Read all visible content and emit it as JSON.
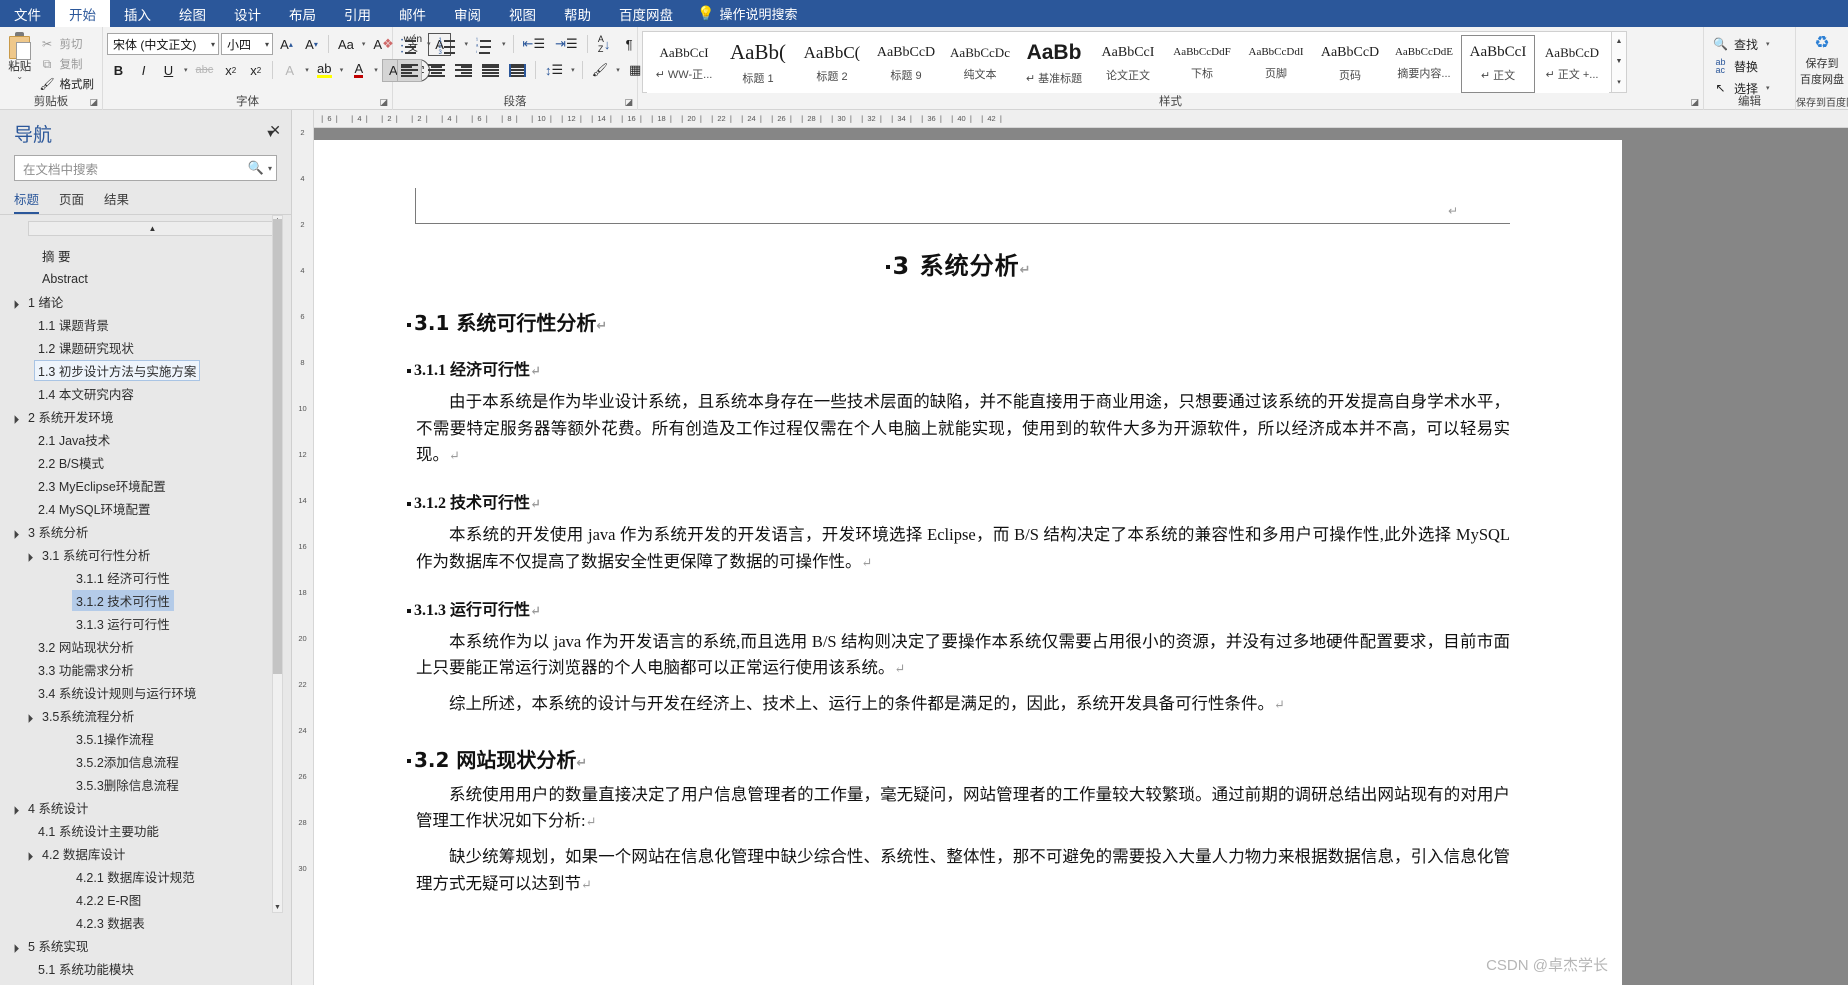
{
  "ribbon": {
    "tabs": [
      {
        "label": "文件",
        "active": false
      },
      {
        "label": "开始",
        "active": true
      },
      {
        "label": "插入",
        "active": false
      },
      {
        "label": "绘图",
        "active": false
      },
      {
        "label": "设计",
        "active": false
      },
      {
        "label": "布局",
        "active": false
      },
      {
        "label": "引用",
        "active": false
      },
      {
        "label": "邮件",
        "active": false
      },
      {
        "label": "审阅",
        "active": false
      },
      {
        "label": "视图",
        "active": false
      },
      {
        "label": "帮助",
        "active": false
      },
      {
        "label": "百度网盘",
        "active": false
      }
    ],
    "tell_me": "操作说明搜索",
    "bulb_icon": "lightbulb-icon",
    "groups": {
      "clipboard": {
        "label": "剪贴板",
        "paste_label": "粘贴",
        "cut_label": "剪切",
        "copy_label": "复制",
        "format_painter_label": "格式刷"
      },
      "font": {
        "label": "字体",
        "font_name": "宋体 (中文正文)",
        "font_size": "小四"
      },
      "paragraph": {
        "label": "段落"
      },
      "styles": {
        "label": "样式",
        "items": [
          {
            "preview": "AaBbCcI",
            "name": "↵ WW-正...",
            "size": 13,
            "serif": true,
            "active": false
          },
          {
            "preview": "AaBb(",
            "name": "标题 1",
            "size": 21,
            "serif": true,
            "active": false
          },
          {
            "preview": "AaBbC(",
            "name": "标题 2",
            "size": 17,
            "serif": true,
            "active": false
          },
          {
            "preview": "AaBbCcD",
            "name": "标题 9",
            "size": 14,
            "serif": true,
            "active": false
          },
          {
            "preview": "AaBbCcDc",
            "name": "纯文本",
            "size": 13,
            "serif": true,
            "active": false
          },
          {
            "preview": "AaBb",
            "name": "↵ 基准标题",
            "size": 21,
            "serif": false,
            "bold": true,
            "active": false
          },
          {
            "preview": "AaBbCcI",
            "name": "论文正文",
            "size": 14,
            "serif": true,
            "active": false
          },
          {
            "preview": "AaBbCcDdF",
            "name": "下标",
            "size": 11,
            "serif": true,
            "active": false
          },
          {
            "preview": "AaBbCcDdI",
            "name": "页脚",
            "size": 11,
            "serif": true,
            "active": false
          },
          {
            "preview": "AaBbCcD",
            "name": "页码",
            "size": 14,
            "serif": true,
            "active": false
          },
          {
            "preview": "AaBbCcDdE",
            "name": "摘要内容...",
            "size": 11,
            "serif": true,
            "active": false
          },
          {
            "preview": "AaBbCcI",
            "name": "↵ 正文",
            "size": 15,
            "serif": true,
            "active": true
          },
          {
            "preview": "AaBbCcD",
            "name": "↵ 正文 +...",
            "size": 13,
            "serif": true,
            "active": false
          }
        ]
      },
      "editing": {
        "label": "编辑",
        "find_label": "查找",
        "replace_label": "替换",
        "select_label": "选择"
      },
      "baidu": {
        "label": "保存到百度网盘",
        "line1": "保存到",
        "line2": "百度网盘"
      }
    }
  },
  "nav": {
    "title": "导航",
    "search_placeholder": "在文档中搜索",
    "tabs": [
      {
        "label": "标题",
        "active": true
      },
      {
        "label": "页面",
        "active": false
      },
      {
        "label": "结果",
        "active": false
      }
    ],
    "items": [
      {
        "label": "摘 要",
        "level": 3,
        "tri": "",
        "state": ""
      },
      {
        "label": "Abstract",
        "level": 3,
        "tri": "",
        "state": ""
      },
      {
        "label": "1 绪论",
        "level": 1,
        "tri": "▲",
        "state": ""
      },
      {
        "label": "1.1 课题背景",
        "level": 2,
        "tri": "",
        "state": ""
      },
      {
        "label": "1.2 课题研究现状",
        "level": 2,
        "tri": "",
        "state": ""
      },
      {
        "label": "1.3 初步设计方法与实施方案",
        "level": 2,
        "tri": "",
        "state": "hov"
      },
      {
        "label": "1.4 本文研究内容",
        "level": 2,
        "tri": "",
        "state": ""
      },
      {
        "label": "2 系统开发环境",
        "level": 1,
        "tri": "▲",
        "state": ""
      },
      {
        "label": "2.1 Java技术",
        "level": 2,
        "tri": "",
        "state": ""
      },
      {
        "label": "2.2 B/S模式",
        "level": 2,
        "tri": "",
        "state": ""
      },
      {
        "label": "2.3 MyEclipse环境配置",
        "level": 2,
        "tri": "",
        "state": ""
      },
      {
        "label": "2.4 MySQL环境配置",
        "level": 2,
        "tri": "",
        "state": ""
      },
      {
        "label": "3 系统分析",
        "level": 1,
        "tri": "▲",
        "state": ""
      },
      {
        "label": "3.1 系统可行性分析",
        "level": 3,
        "tri": "▲",
        "state": ""
      },
      {
        "label": "3.1.1 经济可行性",
        "level": 4,
        "tri": "",
        "state": ""
      },
      {
        "label": "3.1.2 技术可行性",
        "level": 4,
        "tri": "",
        "state": "sel"
      },
      {
        "label": "3.1.3 运行可行性",
        "level": 4,
        "tri": "",
        "state": ""
      },
      {
        "label": "3.2 网站现状分析",
        "level": 2,
        "tri": "",
        "state": ""
      },
      {
        "label": "3.3 功能需求分析",
        "level": 2,
        "tri": "",
        "state": ""
      },
      {
        "label": "3.4 系统设计规则与运行环境",
        "level": 2,
        "tri": "",
        "state": ""
      },
      {
        "label": "3.5系统流程分析",
        "level": 3,
        "tri": "▲",
        "state": ""
      },
      {
        "label": "3.5.1操作流程",
        "level": 4,
        "tri": "",
        "state": ""
      },
      {
        "label": "3.5.2添加信息流程",
        "level": 4,
        "tri": "",
        "state": ""
      },
      {
        "label": "3.5.3删除信息流程",
        "level": 4,
        "tri": "",
        "state": ""
      },
      {
        "label": "4 系统设计",
        "level": 1,
        "tri": "▲",
        "state": ""
      },
      {
        "label": "4.1 系统设计主要功能",
        "level": 2,
        "tri": "",
        "state": ""
      },
      {
        "label": "4.2 数据库设计",
        "level": 3,
        "tri": "▲",
        "state": ""
      },
      {
        "label": "4.2.1 数据库设计规范",
        "level": 4,
        "tri": "",
        "state": ""
      },
      {
        "label": "4.2.2 E-R图",
        "level": 4,
        "tri": "",
        "state": ""
      },
      {
        "label": "4.2.3 数据表",
        "level": 4,
        "tri": "",
        "state": ""
      },
      {
        "label": "5 系统实现",
        "level": 1,
        "tri": "▲",
        "state": ""
      },
      {
        "label": "5.1 系统功能模块",
        "level": 2,
        "tri": "",
        "state": ""
      }
    ]
  },
  "document": {
    "header_pilcrow": "↵",
    "title": "3  系统分析",
    "blocks": [
      {
        "type": "h2",
        "text": "3.1  系统可行性分析"
      },
      {
        "type": "h3",
        "text": "3.1.1  经济可行性"
      },
      {
        "type": "p",
        "text": "由于本系统是作为毕业设计系统，且系统本身存在一些技术层面的缺陷，并不能直接用于商业用途，只想要通过该系统的开发提高自身学术水平，不需要特定服务器等额外花费。所有创造及工作过程仅需在个人电脑上就能实现，使用到的软件大多为开源软件，所以经济成本并不高，可以轻易实现。"
      },
      {
        "type": "h3",
        "text": "3.1.2  技术可行性"
      },
      {
        "type": "p",
        "text": "本系统的开发使用 java 作为系统开发的开发语言，开发环境选择 Eclipse，而 B/S 结构决定了本系统的兼容性和多用户可操作性,此外选择 MySQL 作为数据库不仅提高了数据安全性更保障了数据的可操作性。"
      },
      {
        "type": "h3",
        "text": "3.1.3  运行可行性"
      },
      {
        "type": "p",
        "text": "本系统作为以 java 作为开发语言的系统,而且选用 B/S 结构则决定了要操作本系统仅需要占用很小的资源，并没有过多地硬件配置要求，目前市面上只要能正常运行浏览器的个人电脑都可以正常运行使用该系统。"
      },
      {
        "type": "p",
        "text": "综上所述，本系统的设计与开发在经济上、技术上、运行上的条件都是满足的，因此，系统开发具备可行性条件。"
      },
      {
        "type": "h2",
        "text": "3.2  网站现状分析"
      },
      {
        "type": "p",
        "text": "系统使用用户的数量直接决定了用户信息管理者的工作量，毫无疑问，网站管理者的工作量较大较繁琐。通过前期的调研总结出网站现有的对用户管理工作状况如下分析:"
      },
      {
        "type": "p",
        "text": "缺少统筹规划，如果一个网站在信息化管理中缺少综合性、系统性、整体性，那不可避免的需要投入大量人力物力来根据数据信息，引入信息化管理方式无疑可以达到节"
      }
    ],
    "pilcrow": "↵",
    "watermark": "CSDN @卓杰学长"
  },
  "rulers": {
    "horizontal": [
      "6",
      "4",
      "2",
      "2",
      "4",
      "6",
      "8",
      "10",
      "12",
      "14",
      "16",
      "18",
      "20",
      "22",
      "24",
      "26",
      "28",
      "30",
      "32",
      "34",
      "36",
      "40",
      "42"
    ],
    "vertical": [
      "2",
      "4",
      "2",
      "4",
      "6",
      "8",
      "10",
      "12",
      "14",
      "16",
      "18",
      "20",
      "22",
      "24",
      "26",
      "28",
      "30"
    ]
  }
}
